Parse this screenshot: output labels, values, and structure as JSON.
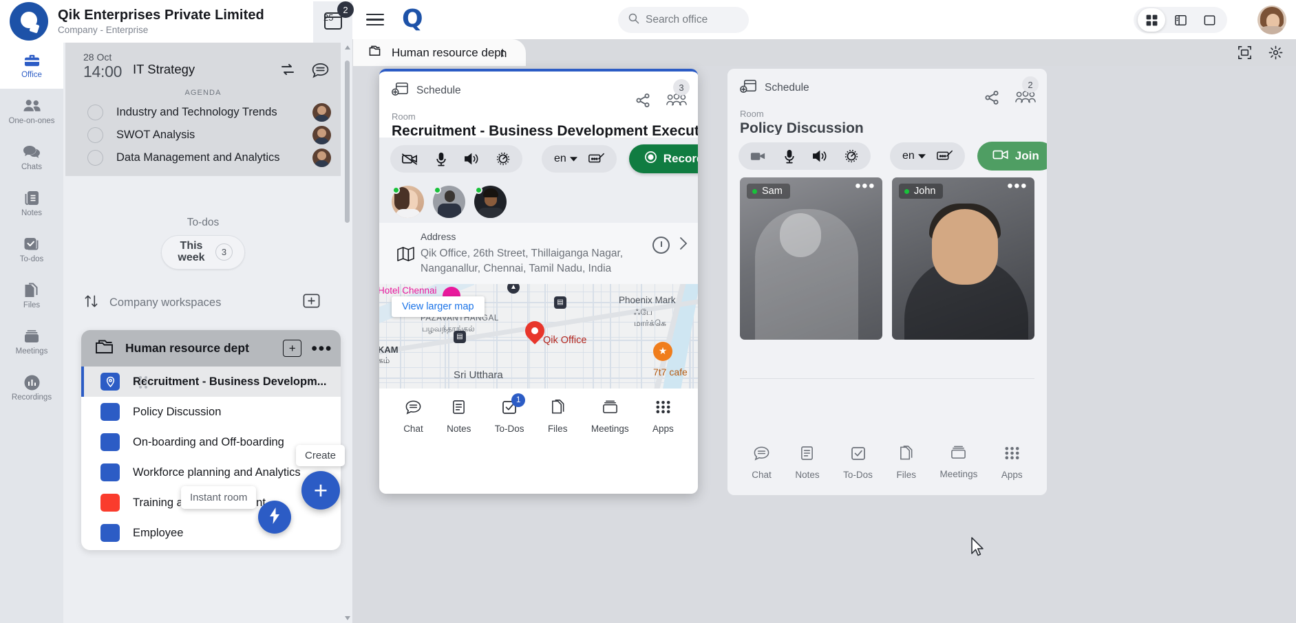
{
  "company": {
    "name": "Qik Enterprises Private Limited",
    "subtitle": "Company - Enterprise",
    "logo_icon": "qik-logo"
  },
  "rail": {
    "items": [
      {
        "label": "Office",
        "icon": "briefcase-icon",
        "active": true
      },
      {
        "label": "One-on-ones",
        "icon": "people-icon",
        "active": false
      },
      {
        "label": "Chats",
        "icon": "chat-bubbles-icon",
        "active": false
      },
      {
        "label": "Notes",
        "icon": "notes-icon",
        "active": false
      },
      {
        "label": "To-dos",
        "icon": "checkbox-stack-icon",
        "active": false
      },
      {
        "label": "Files",
        "icon": "files-icon",
        "active": false
      },
      {
        "label": "Meetings",
        "icon": "meetings-icon",
        "active": false
      },
      {
        "label": "Recordings",
        "icon": "recordings-icon",
        "active": false
      }
    ]
  },
  "agenda": {
    "date": "28 Oct",
    "time": "14:00",
    "meeting_name": "IT Strategy",
    "repeat_icon": "repeat-icon",
    "chat_icon": "chat-icon",
    "section_label": "AGENDA",
    "items": [
      {
        "text": "Industry and Technology Trends"
      },
      {
        "text": "SWOT Analysis"
      },
      {
        "text": "Data Management and Analytics"
      }
    ]
  },
  "todos": {
    "title": "To-dos",
    "chip_label": "This week",
    "chip_count": "3"
  },
  "workspaces_header": {
    "label": "Company workspaces",
    "sort_icon": "sort-arrows-icon",
    "add_icon": "add-workspace-icon"
  },
  "workspace": {
    "name": "Human resource dept",
    "folder_icon": "folder-icon",
    "add_label": "+",
    "more_label": "•••",
    "rooms": [
      {
        "name": "Recruitment - Business Developm...",
        "color": "#2c5cc5",
        "selected": true,
        "icon": "location-pin-icon"
      },
      {
        "name": "Policy Discussion",
        "color": "#2c5cc5",
        "selected": false
      },
      {
        "name": "On-boarding and Off-boarding",
        "color": "#2c5cc5",
        "selected": false
      },
      {
        "name": "Workforce planning and Analytics",
        "color": "#2c5cc5",
        "selected": false
      },
      {
        "name": "Training and Development",
        "color": "#fa3c2d",
        "selected": false
      },
      {
        "name": "Employee",
        "color": "#2c5cc5",
        "selected": false
      }
    ]
  },
  "tooltips": {
    "create": "Create",
    "instant_room": "Instant room"
  },
  "fabs": {
    "bolt_icon": "lightning-bolt-icon",
    "plus_label": "+"
  },
  "calendar_badge": {
    "day": "25",
    "count": "2",
    "icon": "calendar-icon"
  },
  "topbar": {
    "menu_icon": "hamburger-menu-icon",
    "logo_text": "Q",
    "search_placeholder": "Search office",
    "search_value": "",
    "search_icon": "search-icon",
    "view_modes": [
      {
        "name": "grid-view",
        "icon": "grid-icon",
        "active": true
      },
      {
        "name": "split-view",
        "icon": "split-panel-icon",
        "active": false
      },
      {
        "name": "single-view",
        "icon": "single-panel-icon",
        "active": false
      }
    ],
    "avatar_name": "user-avatar"
  },
  "tabstrip": {
    "active_tab": "Human resource dept",
    "tab_icon": "folder-icon",
    "partial_tab": "n",
    "qr_icon": "qr-scan-icon",
    "settings_icon": "gear-icon"
  },
  "cards": [
    {
      "id": "recruitment",
      "schedule_label": "Schedule",
      "schedule_icon": "add-calendar-icon",
      "room_label": "Room",
      "room_name": "Recruitment - Business Development Executive",
      "share_icon": "share-icon",
      "people_icon": "people-group-icon",
      "people_count": "3",
      "controls": {
        "video_icon": "video-off-icon",
        "mic_icon": "microphone-icon",
        "speaker_icon": "speaker-icon",
        "settings_icon": "settings-gear-icon",
        "language": "en",
        "whiteboard_icon": "whiteboard-icon",
        "action_label": "Record",
        "action_icon": "record-icon",
        "caret_icon": "chevron-down-icon"
      },
      "participants": [
        "participant-1",
        "participant-2",
        "participant-3"
      ],
      "address": {
        "label": "Address",
        "text": "Qik Office, 26th Street, Thillaiganga Nagar, Nanganallur, Chennai, Tamil Nadu, India",
        "map_icon": "map-icon",
        "clock_icon": "clock-icon",
        "chevron_icon": "chevron-right-icon"
      },
      "map": {
        "view_larger": "View larger map",
        "labels": [
          {
            "text": "Hotel Chennai",
            "color": "#e8199c"
          },
          {
            "text": "Phoenix Mark",
            "color": "#4a4f57"
          },
          {
            "text": "ஃபே\nமார்க்கெ",
            "color": "#4a4f57"
          },
          {
            "text": "PAZAVANTHANGAL",
            "color": "#5d636b"
          },
          {
            "text": "பழவந்தாங்கல்",
            "color": "#5d636b"
          },
          {
            "text": "KAM",
            "color": "#3c4148"
          },
          {
            "text": "கம்",
            "color": "#3c4148"
          },
          {
            "text": "Sri Utthara",
            "color": "#4a4f57"
          },
          {
            "text": "Qik Office",
            "color": "#b3261e"
          },
          {
            "text": "7t7 cafe",
            "color": "#b55a10"
          }
        ]
      },
      "tabs": [
        {
          "label": "Chat",
          "icon": "chat-icon",
          "badge": ""
        },
        {
          "label": "Notes",
          "icon": "notes-icon",
          "badge": ""
        },
        {
          "label": "To-Dos",
          "icon": "checkbox-icon",
          "badge": "1"
        },
        {
          "label": "Files",
          "icon": "files-icon",
          "badge": ""
        },
        {
          "label": "Meetings",
          "icon": "meetings-icon",
          "badge": ""
        },
        {
          "label": "Apps",
          "icon": "apps-grid-icon",
          "badge": ""
        }
      ]
    },
    {
      "id": "policy",
      "schedule_label": "Schedule",
      "schedule_icon": "add-calendar-icon",
      "room_label": "Room",
      "room_name": "Policy Discussion",
      "share_icon": "share-icon",
      "people_icon": "people-group-icon",
      "people_count": "2",
      "controls": {
        "video_icon": "video-icon",
        "mic_icon": "microphone-icon",
        "speaker_icon": "speaker-icon",
        "settings_icon": "settings-gear-icon",
        "language": "en",
        "whiteboard_icon": "whiteboard-icon",
        "action_label": "Join",
        "action_icon": "video-camera-icon",
        "caret_icon": "chevron-down-icon"
      },
      "videos": [
        {
          "name": "Sam",
          "more_icon": "more-dots-icon"
        },
        {
          "name": "John",
          "more_icon": "more-dots-icon"
        }
      ],
      "tabs": [
        {
          "label": "Chat",
          "icon": "chat-icon",
          "badge": ""
        },
        {
          "label": "Notes",
          "icon": "notes-icon",
          "badge": ""
        },
        {
          "label": "To-Dos",
          "icon": "checkbox-icon",
          "badge": ""
        },
        {
          "label": "Files",
          "icon": "files-icon",
          "badge": ""
        },
        {
          "label": "Meetings",
          "icon": "meetings-icon",
          "badge": ""
        },
        {
          "label": "Apps",
          "icon": "apps-grid-icon",
          "badge": ""
        }
      ]
    }
  ],
  "colors": {
    "brand_blue": "#2c5cc5",
    "logo_blue": "#1d52a8",
    "record_green": "#107c41",
    "join_green": "#4f9e63",
    "red": "#fa3c2d"
  }
}
